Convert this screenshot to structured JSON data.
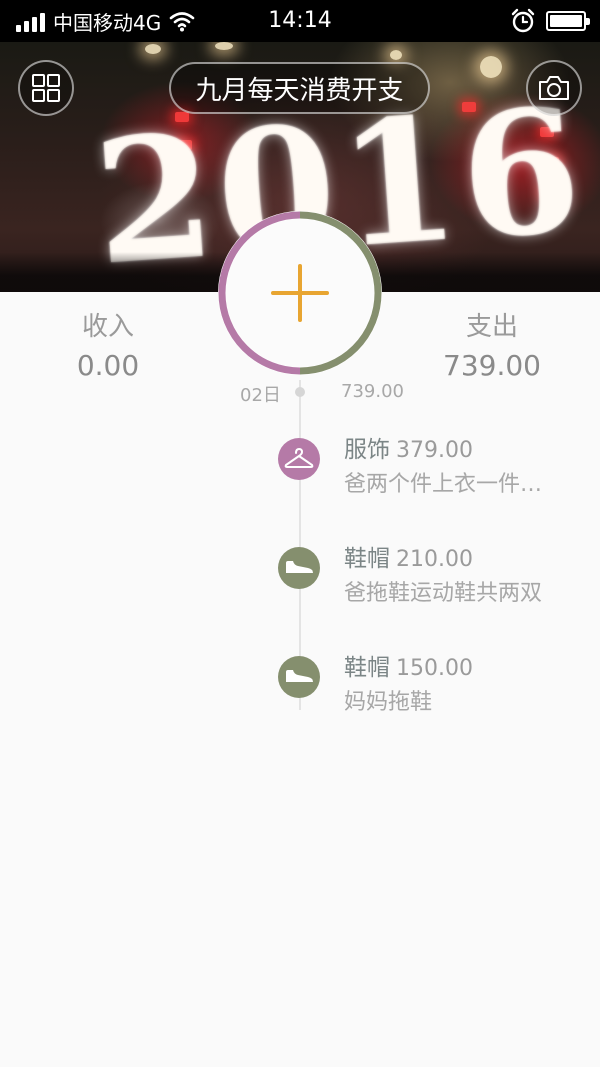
{
  "status_bar": {
    "carrier": "中国移动4G",
    "time": "14:14"
  },
  "header": {
    "title": "九月每天消费开支",
    "banner_text": "2016",
    "menu_icon": "grid-icon",
    "camera_icon": "camera-icon"
  },
  "summary": {
    "income_label": "收入",
    "income_value": "0.00",
    "expense_label": "支出",
    "expense_value": "739.00"
  },
  "add_button": {
    "icon": "plus-icon",
    "accent": "#e8a531",
    "ring_colors": [
      "#b57aa7",
      "#858f6e"
    ],
    "ring_split": 0.5
  },
  "timeline": {
    "date": "02日",
    "day_total": "739.00",
    "entries": [
      {
        "category": "服饰",
        "amount": "379.00",
        "note": "爸两个件上衣一件…",
        "icon": "hanger-icon",
        "color": "#b57aa7"
      },
      {
        "category": "鞋帽",
        "amount": "210.00",
        "note": "爸拖鞋运动鞋共两双",
        "icon": "shoe-icon",
        "color": "#858f6e"
      },
      {
        "category": "鞋帽",
        "amount": "150.00",
        "note": "妈妈拖鞋",
        "icon": "shoe-icon",
        "color": "#858f6e"
      }
    ]
  }
}
